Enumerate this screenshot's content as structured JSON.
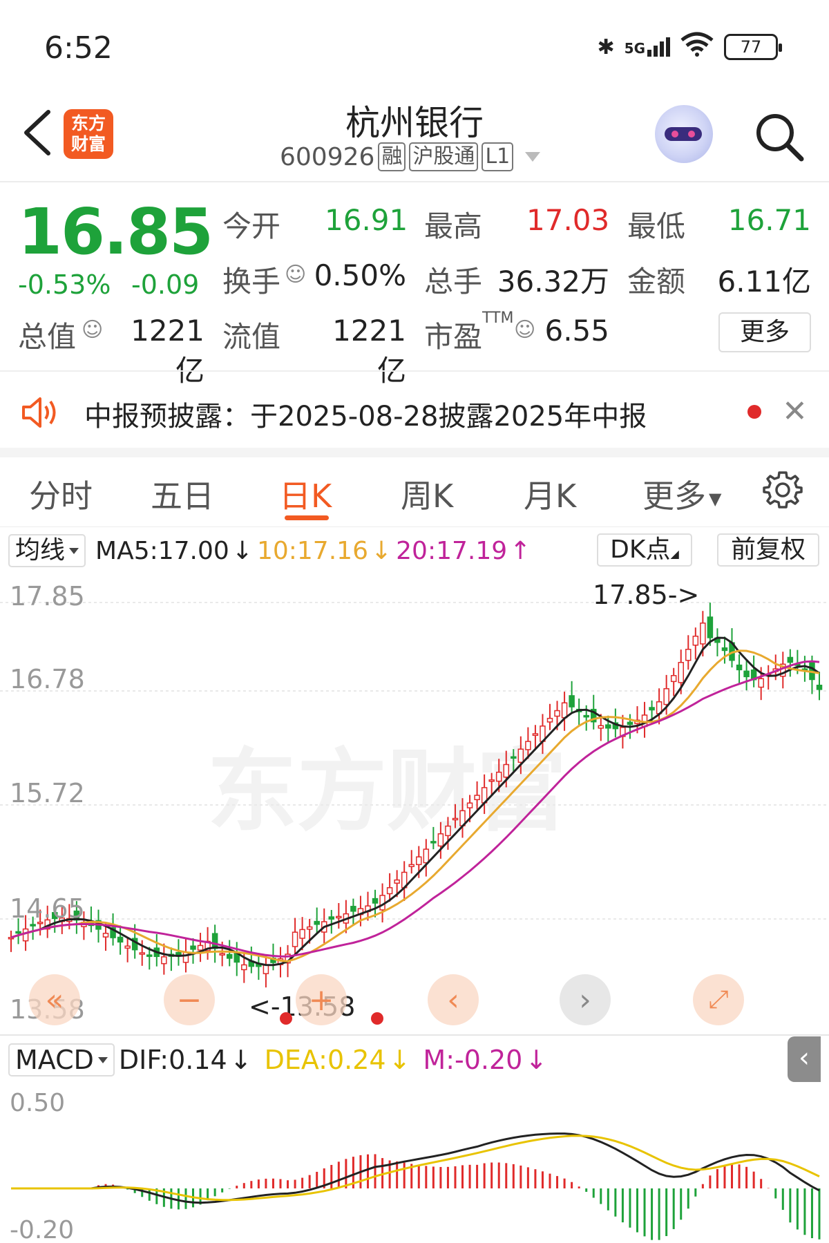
{
  "status_bar": {
    "time": "6:52",
    "network": "5G",
    "battery": "77"
  },
  "header": {
    "logo_line1": "东方",
    "logo_line2": "财富",
    "title": "杭州银行",
    "code": "600926",
    "tags": [
      "融",
      "沪股通",
      "L1"
    ]
  },
  "quote": {
    "price": "16.85",
    "change_pct": "-0.53%",
    "change": "-0.09",
    "fields": [
      {
        "label": "今开",
        "value": "16.91",
        "color": "#1ea23a"
      },
      {
        "label": "最高",
        "value": "17.03",
        "color": "#e02a2a"
      },
      {
        "label": "最低",
        "value": "16.71",
        "color": "#1ea23a"
      },
      {
        "label": "换手",
        "value": "0.50%"
      },
      {
        "label": "总手",
        "value": "36.32万"
      },
      {
        "label": "金额",
        "value": "6.11亿"
      },
      {
        "label": "总值",
        "value": "1221亿"
      },
      {
        "label": "流值",
        "value": "1221亿"
      },
      {
        "label": "市盈",
        "sup": "TTM",
        "value": "6.55"
      }
    ],
    "more_label": "更多"
  },
  "notice": {
    "text": "中报预披露：于2025-08-28披露2025年中报"
  },
  "tabs": {
    "items": [
      "分时",
      "五日",
      "日K",
      "周K",
      "月K",
      "更多"
    ],
    "active": 2
  },
  "ma_legend": {
    "selector": "均线",
    "ma5": "MA5:17.00",
    "ma10": "10:17.16",
    "ma20": "20:17.19",
    "dk_label": "DK点",
    "adjust_label": "前复权",
    "colors": {
      "ma5": "#222222",
      "ma10": "#e8a92f",
      "ma20": "#c0239a"
    }
  },
  "kline": {
    "price_levels": [
      "17.85",
      "16.78",
      "15.72",
      "14.65",
      "13.58"
    ],
    "max_label": "17.85->",
    "min_label": "<-13.58",
    "watermark": "东方财富",
    "up_color": "#e02a2a",
    "down_color": "#1ea23a"
  },
  "macd": {
    "selector": "MACD",
    "dif": "DIF:0.14",
    "dea": "DEA:0.24",
    "m": "M:-0.20",
    "top_level": "0.50",
    "bottom_level": "-0.20"
  }
}
